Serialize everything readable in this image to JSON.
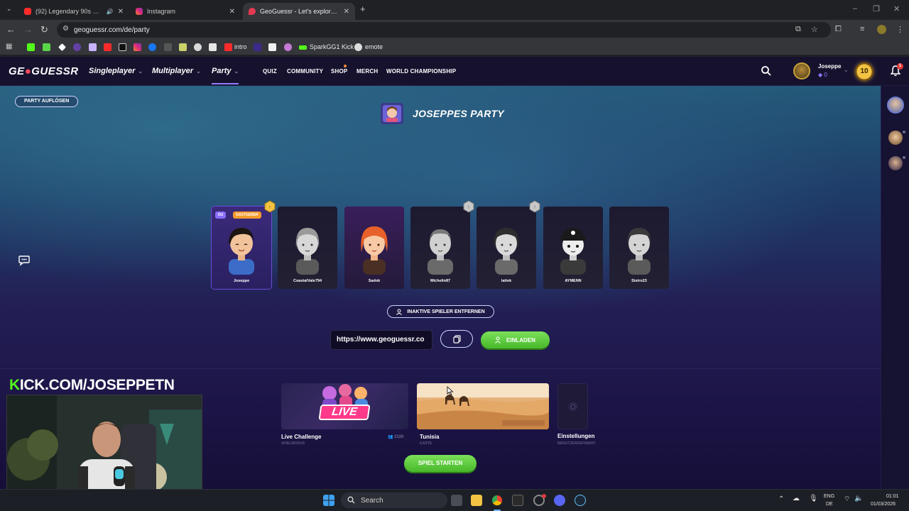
{
  "browser": {
    "tabs": [
      {
        "title": "(92) Legendary 90s & 2000s",
        "active": false,
        "favicon_color": "#ff2b2b"
      },
      {
        "title": "Instagram",
        "active": false,
        "favicon_color": "#d6249f"
      },
      {
        "title": "GeoGuessr - Let's explore the w",
        "active": true,
        "favicon_color": "#e53950"
      }
    ],
    "url": "geoguessr.com/de/party",
    "bookmarks": [
      {
        "label": "intro"
      },
      {
        "label": "SparkGG1 Kick"
      },
      {
        "label": "emote"
      }
    ]
  },
  "header": {
    "logo": {
      "pre": "GE",
      "post": "GUESSR"
    },
    "nav": {
      "singleplayer": "Singleplayer",
      "multiplayer": "Multiplayer",
      "party": "Party"
    },
    "subnav": {
      "quiz": "QUIZ",
      "community": "COMMUNITY",
      "shop": "SHOP",
      "merch": "MERCH",
      "championship": "WORLD CHAMPIONSHIP"
    },
    "user": {
      "name": "Joseppe",
      "coins": "0",
      "level": "10"
    },
    "notifications": "1"
  },
  "party": {
    "disband_label": "PARTY AUFLÖSEN",
    "title": "JOSEPPES PARTY",
    "players": [
      {
        "name": "Joseppe",
        "tag_you": "DU",
        "tag_host": "GASTGEBER",
        "medal": "gold"
      },
      {
        "name": "CoastalVale794"
      },
      {
        "name": "Sadok"
      },
      {
        "name": "Michelin87",
        "medal": "silver"
      },
      {
        "name": "lattek",
        "medal": "silver"
      },
      {
        "name": "AYMENN"
      },
      {
        "name": "Sistro23"
      }
    ],
    "remove_inactive_label": "INAKTIVE SPIELER ENTFERNEN",
    "invite_link": "https://www.geoguessr.co",
    "invite_label": "EINLADEN"
  },
  "games": {
    "live": {
      "banner": "LIVE",
      "label": "Live Challenge",
      "sub": "SPIELMODUS",
      "players": "2100"
    },
    "map": {
      "label": "Tunisia",
      "sub": "KARTE"
    },
    "settings": {
      "label": "Einstellungen",
      "sub": "BENUTZERDEFINIERT"
    },
    "start_label": "SPIEL STARTEN"
  },
  "overlay": {
    "kick_k": "K",
    "kick_rest": "ICK.COM/JOSEPPETN"
  },
  "taskbar": {
    "search": "Search",
    "lang_top": "ENG",
    "lang_bottom": "DE",
    "time": "01:01",
    "date": "01/03/2026"
  }
}
